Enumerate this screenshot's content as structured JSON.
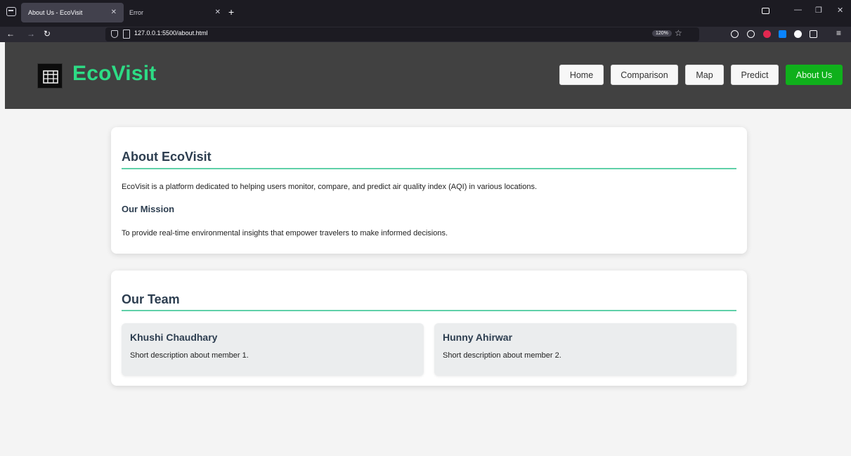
{
  "browser": {
    "tabs": [
      {
        "title": "About Us - EcoVisit",
        "active": true
      },
      {
        "title": "Error",
        "active": false
      }
    ],
    "url": "127.0.0.1:5500/about.html",
    "zoom": "120%"
  },
  "site": {
    "brand": "EcoVisit",
    "nav": [
      "Home",
      "Comparison",
      "Map",
      "Predict",
      "About Us"
    ],
    "active_nav": "About Us",
    "brand_color": "#2ddc85",
    "active_color": "#0fb01b"
  },
  "about": {
    "title": "About EcoVisit",
    "intro": "EcoVisit is a platform dedicated to helping users monitor, compare, and predict air quality index (AQI) in various locations.",
    "mission_title": "Our Mission",
    "mission_text": "To provide real-time environmental insights that empower travelers to make informed decisions."
  },
  "team": {
    "title": "Our Team",
    "members": [
      {
        "name": "Khushi Chaudhary",
        "desc": "Short description about member 1."
      },
      {
        "name": "Hunny Ahirwar",
        "desc": "Short description about member 2."
      }
    ]
  }
}
